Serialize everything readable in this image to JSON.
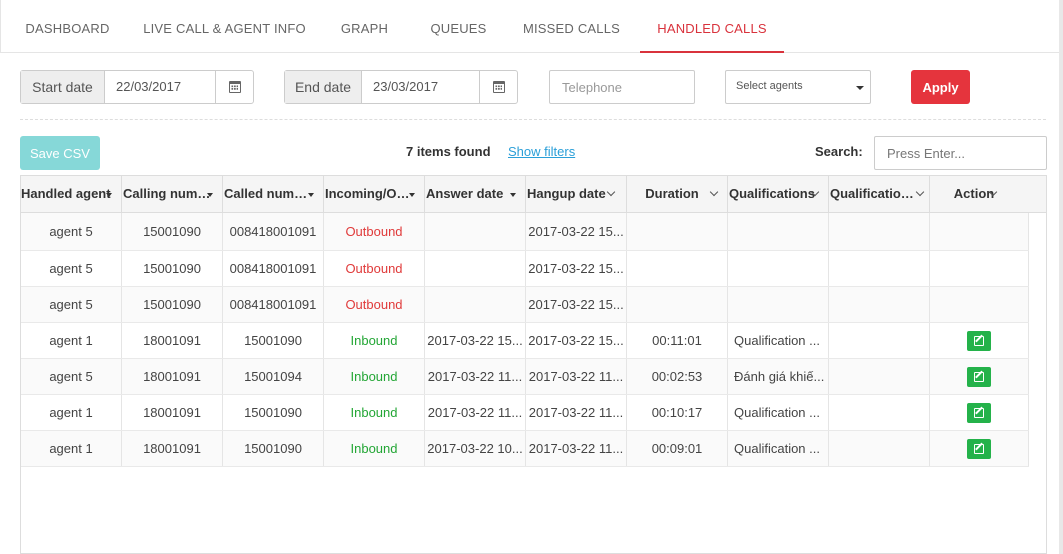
{
  "tabs": [
    {
      "label": "DASHBOARD",
      "active": false
    },
    {
      "label": "LIVE CALL & AGENT INFO",
      "active": false
    },
    {
      "label": "GRAPH",
      "active": false
    },
    {
      "label": "QUEUES",
      "active": false
    },
    {
      "label": "MISSED CALLS",
      "active": false
    },
    {
      "label": "HANDLED CALLS",
      "active": true
    }
  ],
  "filters": {
    "start_label": "Start date",
    "start_value": "22/03/2017",
    "end_label": "End date",
    "end_value": "23/03/2017",
    "telephone_placeholder": "Telephone",
    "agents_select": "Select agents",
    "apply_label": "Apply"
  },
  "toolbar": {
    "save_csv_label": "Save CSV",
    "items_found": "7 items found",
    "show_filters": "Show filters",
    "search_label": "Search:",
    "search_placeholder": "Press Enter..."
  },
  "table": {
    "headers": [
      "Handled agent",
      "Calling numbe...",
      "Called number",
      "Incoming/Out...",
      "Answer date",
      "Hangup date",
      "Duration",
      "Qualifications",
      "Qualification ...",
      "Action"
    ],
    "rows": [
      {
        "agent": "agent 5",
        "calling": "15001090",
        "called": "008418001091",
        "direction": "Outbound",
        "answer": "",
        "hangup": "2017-03-22 15...",
        "duration": "",
        "qualification": "",
        "qualification2": "",
        "action": false
      },
      {
        "agent": "agent 5",
        "calling": "15001090",
        "called": "008418001091",
        "direction": "Outbound",
        "answer": "",
        "hangup": "2017-03-22 15...",
        "duration": "",
        "qualification": "",
        "qualification2": "",
        "action": false
      },
      {
        "agent": "agent 5",
        "calling": "15001090",
        "called": "008418001091",
        "direction": "Outbound",
        "answer": "",
        "hangup": "2017-03-22 15...",
        "duration": "",
        "qualification": "",
        "qualification2": "",
        "action": false
      },
      {
        "agent": "agent 1",
        "calling": "18001091",
        "called": "15001090",
        "direction": "Inbound",
        "answer": "2017-03-22 15...",
        "hangup": "2017-03-22 15...",
        "duration": "00:11:01",
        "qualification": "Qualification ...",
        "qualification2": "",
        "action": true
      },
      {
        "agent": "agent 5",
        "calling": "18001091",
        "called": "15001094",
        "direction": "Inbound",
        "answer": "2017-03-22 11...",
        "hangup": "2017-03-22 11...",
        "duration": "00:02:53",
        "qualification": "Đánh giá khiế...",
        "qualification2": "",
        "action": true
      },
      {
        "agent": "agent 1",
        "calling": "18001091",
        "called": "15001090",
        "direction": "Inbound",
        "answer": "2017-03-22 11...",
        "hangup": "2017-03-22 11...",
        "duration": "00:10:17",
        "qualification": "Qualification ...",
        "qualification2": "",
        "action": true
      },
      {
        "agent": "agent 1",
        "calling": "18001091",
        "called": "15001090",
        "direction": "Inbound",
        "answer": "2017-03-22 10...",
        "hangup": "2017-03-22 11...",
        "duration": "00:09:01",
        "qualification": "Qualification ...",
        "qualification2": "",
        "action": true
      }
    ]
  },
  "colors": {
    "accent": "#d9323c",
    "outbound": "#e03a3a",
    "inbound": "#23a635",
    "apply": "#e5343d",
    "save_csv": "#86d8d8",
    "link": "#2a9fd8",
    "edit": "#24b24a"
  }
}
